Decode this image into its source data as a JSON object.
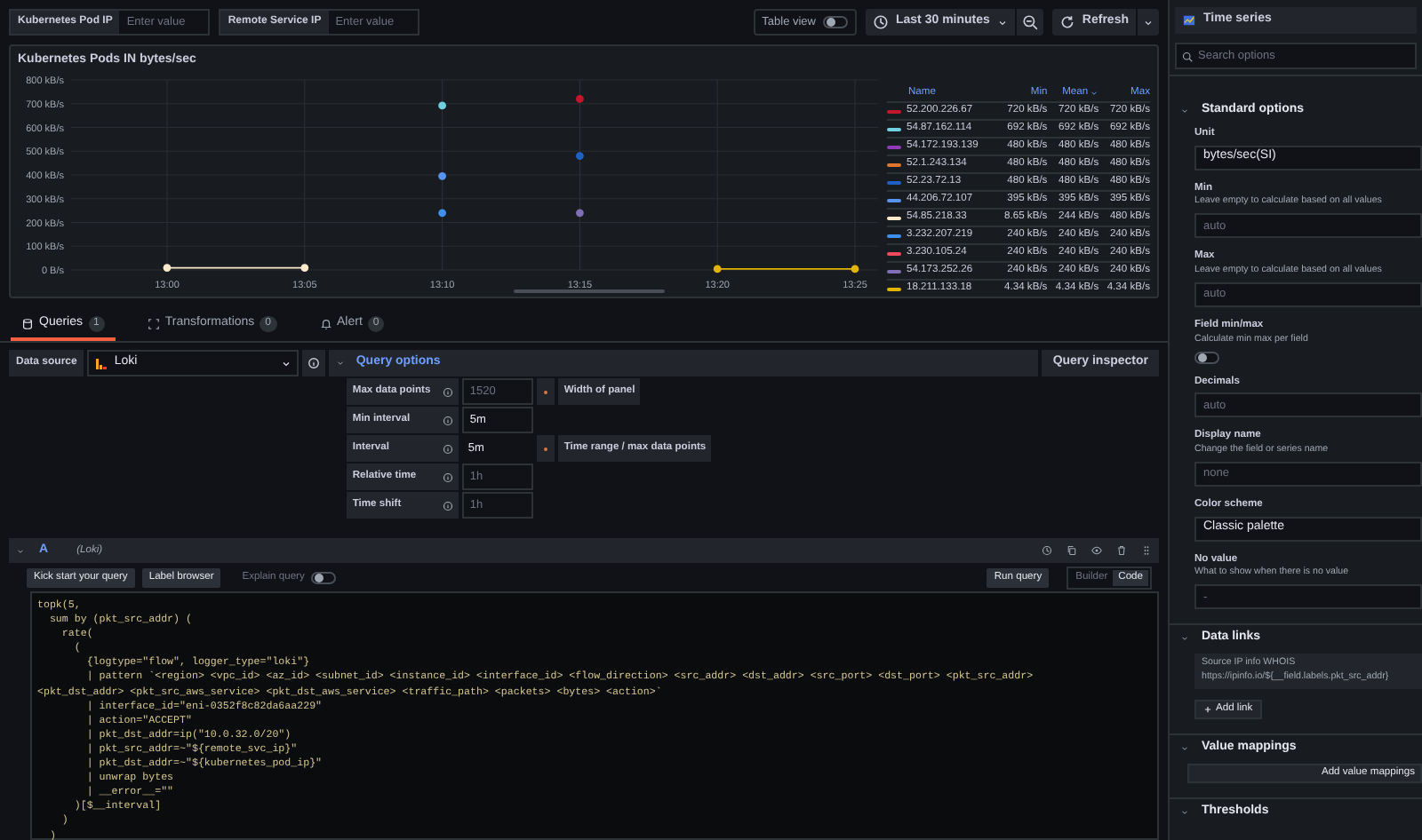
{
  "variables": [
    {
      "label": "Kubernetes Pod IP",
      "placeholder": "Enter value"
    },
    {
      "label": "Remote Service IP",
      "placeholder": "Enter value"
    }
  ],
  "toolbar": {
    "table_view": {
      "label": "Table view",
      "on": false
    },
    "time_range": "Last 30 minutes",
    "refresh": "Refresh"
  },
  "panel": {
    "title": "Kubernetes Pods IN bytes/sec",
    "legend": {
      "columns": [
        {
          "label": "Name",
          "sorted": false
        },
        {
          "label": "Min",
          "sorted": false
        },
        {
          "label": "Mean",
          "sorted": true
        },
        {
          "label": "Max",
          "sorted": false
        }
      ],
      "rows": [
        {
          "min": "720 kB/s",
          "mean": "720 kB/s",
          "max": "720 kB/s"
        },
        {
          "min": "692 kB/s",
          "mean": "692 kB/s",
          "max": "692 kB/s"
        },
        {
          "min": "480 kB/s",
          "mean": "480 kB/s",
          "max": "480 kB/s"
        },
        {
          "min": "480 kB/s",
          "mean": "480 kB/s",
          "max": "480 kB/s"
        },
        {
          "min": "480 kB/s",
          "mean": "480 kB/s",
          "max": "480 kB/s"
        },
        {
          "min": "395 kB/s",
          "mean": "395 kB/s",
          "max": "395 kB/s"
        },
        {
          "min": "8.65 kB/s",
          "mean": "244 kB/s",
          "max": "480 kB/s"
        },
        {
          "min": "240 kB/s",
          "mean": "240 kB/s",
          "max": "240 kB/s"
        },
        {
          "min": "240 kB/s",
          "mean": "240 kB/s",
          "max": "240 kB/s"
        },
        {
          "min": "240 kB/s",
          "mean": "240 kB/s",
          "max": "240 kB/s"
        },
        {
          "min": "4.34 kB/s",
          "mean": "4.34 kB/s",
          "max": "4.34 kB/s"
        }
      ]
    },
    "chart_data": {
      "type": "line",
      "grid": true,
      "x": [
        "13:00",
        "13:05",
        "13:10",
        "13:15",
        "13:20",
        "13:25"
      ],
      "ylim": [
        0,
        800
      ],
      "yticks": [
        {
          "value": 0,
          "label": "0 B/s"
        },
        {
          "value": 100,
          "label": "100 kB/s"
        },
        {
          "value": 200,
          "label": "200 kB/s"
        },
        {
          "value": 300,
          "label": "300 kB/s"
        },
        {
          "value": 400,
          "label": "400 kB/s"
        },
        {
          "value": 500,
          "label": "500 kB/s"
        },
        {
          "value": 600,
          "label": "600 kB/s"
        },
        {
          "value": 700,
          "label": "700 kB/s"
        },
        {
          "value": 800,
          "label": "800 kB/s"
        }
      ],
      "series": [
        {
          "name": "52.200.226.67",
          "color": "#c4162a",
          "marker": true,
          "values": [
            null,
            null,
            null,
            720,
            null,
            null
          ]
        },
        {
          "name": "54.87.162.114",
          "color": "#6ed0e0",
          "marker": true,
          "values": [
            null,
            null,
            692,
            null,
            null,
            null
          ]
        },
        {
          "name": "54.172.193.139",
          "color": "#8f3bb8",
          "values": [
            null,
            null,
            null,
            null,
            null,
            null
          ]
        },
        {
          "name": "52.1.243.134",
          "color": "#e0752d",
          "values": [
            null,
            null,
            null,
            null,
            null,
            null
          ]
        },
        {
          "name": "52.23.72.13",
          "color": "#1f60c4",
          "marker": true,
          "values": [
            null,
            null,
            null,
            480,
            null,
            null
          ]
        },
        {
          "name": "44.206.72.107",
          "color": "#5794f2",
          "marker": true,
          "values": [
            null,
            null,
            395,
            null,
            null,
            null
          ]
        },
        {
          "name": "54.85.218.33",
          "color": "#fceaca",
          "marker": true,
          "values": [
            9,
            9,
            null,
            null,
            null,
            null
          ]
        },
        {
          "name": "3.232.207.219",
          "color": "#3d8ff0",
          "marker": true,
          "values": [
            null,
            null,
            240,
            null,
            null,
            null
          ]
        },
        {
          "name": "3.230.105.24",
          "color": "#f2495c",
          "values": [
            null,
            null,
            null,
            null,
            null,
            null
          ]
        },
        {
          "name": "54.173.252.26",
          "color": "#806eb7",
          "marker": true,
          "values": [
            null,
            null,
            null,
            240,
            null,
            null
          ]
        },
        {
          "name": "18.211.133.18",
          "color": "#e0b400",
          "marker": true,
          "values": [
            null,
            null,
            null,
            null,
            4,
            4
          ]
        }
      ]
    }
  },
  "query_tabs": [
    {
      "label": "Queries",
      "count": "1",
      "selected": true
    },
    {
      "label": "Transformations",
      "count": "0",
      "selected": false
    },
    {
      "label": "Alert",
      "count": "0",
      "selected": false
    }
  ],
  "data_source": {
    "label": "Data source",
    "value": "Loki"
  },
  "query_options": {
    "title": "Query options",
    "expanded": true,
    "rows": [
      {
        "label": "Max data points",
        "placeholder": "1520",
        "hint": "Width of panel"
      },
      {
        "label": "Min interval",
        "value": "5m"
      },
      {
        "label": "Interval",
        "value": "5m",
        "readonly": true,
        "hint": "Time range / max data points"
      },
      {
        "label": "Relative time",
        "placeholder": "1h"
      },
      {
        "label": "Time shift",
        "placeholder": "1h"
      }
    ]
  },
  "query_inspector": "Query inspector",
  "query": {
    "ref": "A",
    "datasource": "(Loki)",
    "expanded": true,
    "buttons": [
      "Kick start your query",
      "Label browser"
    ],
    "explain": {
      "label": "Explain query",
      "on": false
    },
    "run": "Run query",
    "modes": [
      {
        "label": "Builder",
        "selected": false
      },
      {
        "label": "Code",
        "selected": true
      }
    ],
    "code": [
      "topk(5,",
      "  sum by (pkt_src_addr) (",
      "    rate(",
      "      (",
      "        {logtype=\"flow\", logger_type=\"loki\"}",
      "        | pattern `<region> <vpc_id> <az_id> <subnet_id> <instance_id> <interface_id> <flow_direction> <src_addr> <dst_addr> <src_port> <dst_port> <pkt_src_addr>",
      "<pkt_dst_addr> <pkt_src_aws_service> <pkt_dst_aws_service> <traffic_path> <packets> <bytes> <action>`",
      "        | interface_id=\"eni-0352f8c82da6aa229\"",
      "        | action=\"ACCEPT\"",
      "        | pkt_dst_addr=ip(\"10.0.32.0/20\")",
      "        | pkt_src_addr=~\"${remote_svc_ip}\"",
      "        | pkt_dst_addr=~\"${kubernetes_pod_ip}\"",
      "        | unwrap bytes",
      "        | __error__=\"\"",
      "      )[$__interval]",
      "    )",
      "  )"
    ]
  },
  "options_pane": {
    "visualization": "Time series",
    "search_placeholder": "Search options",
    "sections": [
      {
        "title": "Standard options",
        "expanded": true,
        "fields": [
          {
            "kind": "select",
            "label": "Unit",
            "value": "bytes/sec(SI)"
          },
          {
            "kind": "input",
            "label": "Min",
            "description": "Leave empty to calculate based on all values",
            "placeholder": "auto"
          },
          {
            "kind": "input",
            "label": "Max",
            "description": "Leave empty to calculate based on all values",
            "placeholder": "auto"
          },
          {
            "kind": "toggle",
            "label": "Field min/max",
            "description": "Calculate min max per field",
            "on": false
          },
          {
            "kind": "input",
            "label": "Decimals",
            "placeholder": "auto"
          },
          {
            "kind": "input",
            "label": "Display name",
            "description": "Change the field or series name",
            "placeholder": "none"
          },
          {
            "kind": "select",
            "label": "Color scheme",
            "value": "Classic palette"
          },
          {
            "kind": "input",
            "label": "No value",
            "description": "What to show when there is no value",
            "placeholder": "-"
          }
        ]
      },
      {
        "title": "Data links",
        "expanded": true,
        "links": [
          {
            "title": "Source IP info WHOIS",
            "url": "https://ipinfo.io/${__field.labels.pkt_src_addr}"
          }
        ],
        "button": "Add link"
      },
      {
        "title": "Value mappings",
        "expanded": true,
        "button": "Add value mappings"
      },
      {
        "title": "Thresholds",
        "expanded": true
      }
    ]
  }
}
